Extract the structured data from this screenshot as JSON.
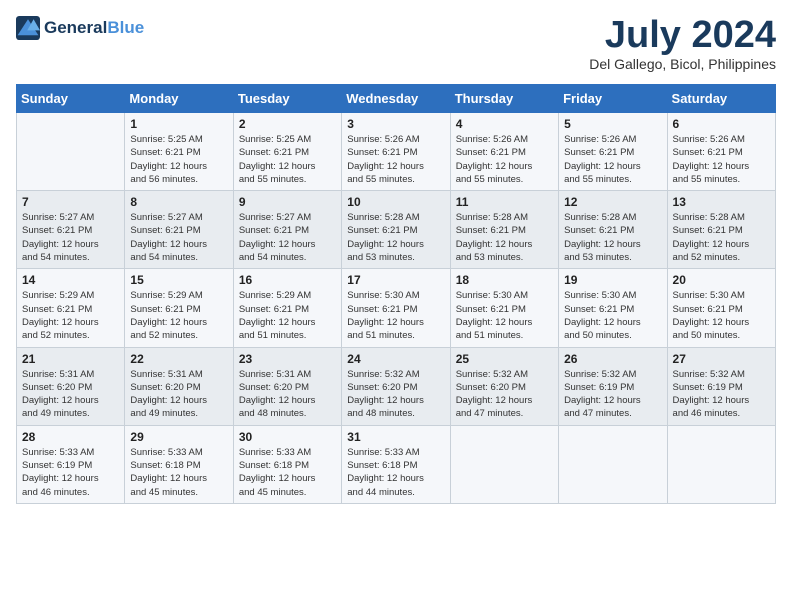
{
  "header": {
    "logo_line1": "General",
    "logo_line2": "Blue",
    "month": "July 2024",
    "location": "Del Gallego, Bicol, Philippines"
  },
  "weekdays": [
    "Sunday",
    "Monday",
    "Tuesday",
    "Wednesday",
    "Thursday",
    "Friday",
    "Saturday"
  ],
  "weeks": [
    [
      {
        "day": "",
        "info": ""
      },
      {
        "day": "1",
        "info": "Sunrise: 5:25 AM\nSunset: 6:21 PM\nDaylight: 12 hours\nand 56 minutes."
      },
      {
        "day": "2",
        "info": "Sunrise: 5:25 AM\nSunset: 6:21 PM\nDaylight: 12 hours\nand 55 minutes."
      },
      {
        "day": "3",
        "info": "Sunrise: 5:26 AM\nSunset: 6:21 PM\nDaylight: 12 hours\nand 55 minutes."
      },
      {
        "day": "4",
        "info": "Sunrise: 5:26 AM\nSunset: 6:21 PM\nDaylight: 12 hours\nand 55 minutes."
      },
      {
        "day": "5",
        "info": "Sunrise: 5:26 AM\nSunset: 6:21 PM\nDaylight: 12 hours\nand 55 minutes."
      },
      {
        "day": "6",
        "info": "Sunrise: 5:26 AM\nSunset: 6:21 PM\nDaylight: 12 hours\nand 55 minutes."
      }
    ],
    [
      {
        "day": "7",
        "info": "Sunrise: 5:27 AM\nSunset: 6:21 PM\nDaylight: 12 hours\nand 54 minutes."
      },
      {
        "day": "8",
        "info": "Sunrise: 5:27 AM\nSunset: 6:21 PM\nDaylight: 12 hours\nand 54 minutes."
      },
      {
        "day": "9",
        "info": "Sunrise: 5:27 AM\nSunset: 6:21 PM\nDaylight: 12 hours\nand 54 minutes."
      },
      {
        "day": "10",
        "info": "Sunrise: 5:28 AM\nSunset: 6:21 PM\nDaylight: 12 hours\nand 53 minutes."
      },
      {
        "day": "11",
        "info": "Sunrise: 5:28 AM\nSunset: 6:21 PM\nDaylight: 12 hours\nand 53 minutes."
      },
      {
        "day": "12",
        "info": "Sunrise: 5:28 AM\nSunset: 6:21 PM\nDaylight: 12 hours\nand 53 minutes."
      },
      {
        "day": "13",
        "info": "Sunrise: 5:28 AM\nSunset: 6:21 PM\nDaylight: 12 hours\nand 52 minutes."
      }
    ],
    [
      {
        "day": "14",
        "info": "Sunrise: 5:29 AM\nSunset: 6:21 PM\nDaylight: 12 hours\nand 52 minutes."
      },
      {
        "day": "15",
        "info": "Sunrise: 5:29 AM\nSunset: 6:21 PM\nDaylight: 12 hours\nand 52 minutes."
      },
      {
        "day": "16",
        "info": "Sunrise: 5:29 AM\nSunset: 6:21 PM\nDaylight: 12 hours\nand 51 minutes."
      },
      {
        "day": "17",
        "info": "Sunrise: 5:30 AM\nSunset: 6:21 PM\nDaylight: 12 hours\nand 51 minutes."
      },
      {
        "day": "18",
        "info": "Sunrise: 5:30 AM\nSunset: 6:21 PM\nDaylight: 12 hours\nand 51 minutes."
      },
      {
        "day": "19",
        "info": "Sunrise: 5:30 AM\nSunset: 6:21 PM\nDaylight: 12 hours\nand 50 minutes."
      },
      {
        "day": "20",
        "info": "Sunrise: 5:30 AM\nSunset: 6:21 PM\nDaylight: 12 hours\nand 50 minutes."
      }
    ],
    [
      {
        "day": "21",
        "info": "Sunrise: 5:31 AM\nSunset: 6:20 PM\nDaylight: 12 hours\nand 49 minutes."
      },
      {
        "day": "22",
        "info": "Sunrise: 5:31 AM\nSunset: 6:20 PM\nDaylight: 12 hours\nand 49 minutes."
      },
      {
        "day": "23",
        "info": "Sunrise: 5:31 AM\nSunset: 6:20 PM\nDaylight: 12 hours\nand 48 minutes."
      },
      {
        "day": "24",
        "info": "Sunrise: 5:32 AM\nSunset: 6:20 PM\nDaylight: 12 hours\nand 48 minutes."
      },
      {
        "day": "25",
        "info": "Sunrise: 5:32 AM\nSunset: 6:20 PM\nDaylight: 12 hours\nand 47 minutes."
      },
      {
        "day": "26",
        "info": "Sunrise: 5:32 AM\nSunset: 6:19 PM\nDaylight: 12 hours\nand 47 minutes."
      },
      {
        "day": "27",
        "info": "Sunrise: 5:32 AM\nSunset: 6:19 PM\nDaylight: 12 hours\nand 46 minutes."
      }
    ],
    [
      {
        "day": "28",
        "info": "Sunrise: 5:33 AM\nSunset: 6:19 PM\nDaylight: 12 hours\nand 46 minutes."
      },
      {
        "day": "29",
        "info": "Sunrise: 5:33 AM\nSunset: 6:18 PM\nDaylight: 12 hours\nand 45 minutes."
      },
      {
        "day": "30",
        "info": "Sunrise: 5:33 AM\nSunset: 6:18 PM\nDaylight: 12 hours\nand 45 minutes."
      },
      {
        "day": "31",
        "info": "Sunrise: 5:33 AM\nSunset: 6:18 PM\nDaylight: 12 hours\nand 44 minutes."
      },
      {
        "day": "",
        "info": ""
      },
      {
        "day": "",
        "info": ""
      },
      {
        "day": "",
        "info": ""
      }
    ]
  ]
}
